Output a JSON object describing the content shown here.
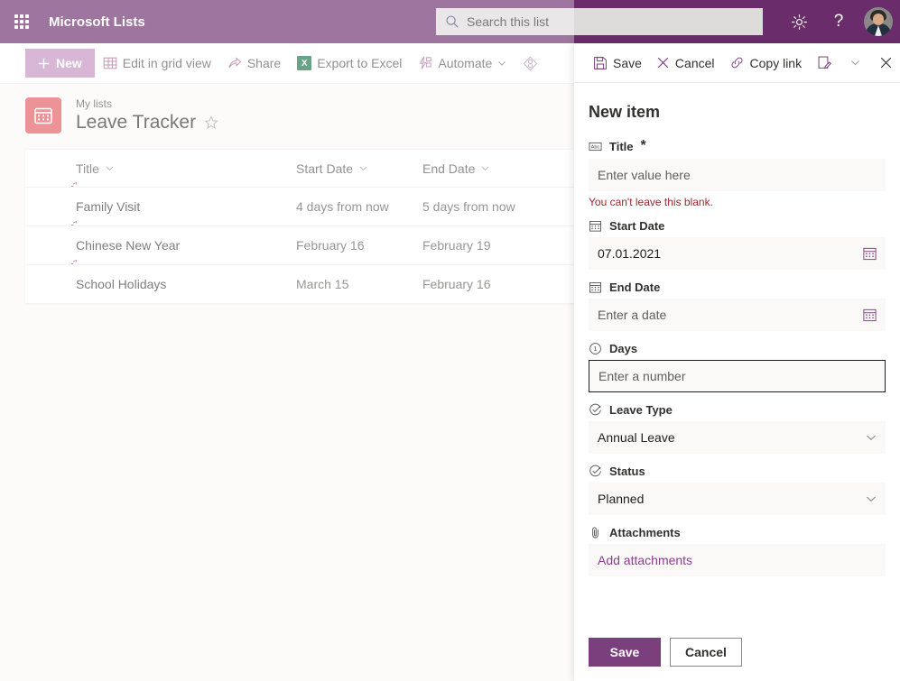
{
  "colors": {
    "brand_purple": "#6b2c6b",
    "accent_purple": "#7b3f7d",
    "new_button": "#c391c0",
    "list_icon_red": "#e35a62",
    "error_red": "#a4262c",
    "field_bg": "#faf9f8",
    "excel_green": "#1d7044"
  },
  "suitebar": {
    "waffle_name": "app-launcher",
    "app_title": "Microsoft Lists",
    "search": {
      "placeholder": "Search this list",
      "value": "",
      "icon": "search-icon"
    },
    "settings_icon": "gear-icon",
    "help_icon": "question-mark-icon",
    "avatar_name": "user-avatar"
  },
  "commandbar": {
    "new_label": "New",
    "items": [
      {
        "label": "Edit in grid view",
        "icon": "grid-icon"
      },
      {
        "label": "Share",
        "icon": "share-icon"
      },
      {
        "label": "Export to Excel",
        "icon": "excel-icon"
      },
      {
        "label": "Automate",
        "icon": "automate-icon",
        "has_chevron": true
      },
      {
        "label": "",
        "icon": "integrate-icon"
      }
    ]
  },
  "list_header": {
    "icon": "calendar-list-icon",
    "breadcrumb": "My lists",
    "title": "Leave Tracker",
    "favorite_icon": "star-icon"
  },
  "table": {
    "columns": [
      "Title",
      "Start Date",
      "End Date"
    ],
    "rows": [
      {
        "title": "Family Visit",
        "start": "4 days from now",
        "end": "5 days from now"
      },
      {
        "title": "Chinese New Year",
        "start": "February 16",
        "end": "February 19"
      },
      {
        "title": "School Holidays",
        "start": "March 15",
        "end": "February 16"
      }
    ]
  },
  "panel": {
    "commands": {
      "save": "Save",
      "cancel": "Cancel",
      "copy_link": "Copy link",
      "edit_form_icon": "edit-form-icon",
      "more_chevron_icon": "chevron-down-icon",
      "close_icon": "close-icon"
    },
    "title": "New item",
    "fields": {
      "title": {
        "label": "Title",
        "required_marker": "*",
        "icon": "text-field-icon",
        "value": "",
        "placeholder": "Enter value here",
        "error": "You can't leave this blank."
      },
      "start_date": {
        "label": "Start Date",
        "icon": "calendar-icon",
        "value": "07.01.2021",
        "placeholder": "Enter a date",
        "picker_icon": "calendar-picker-icon"
      },
      "end_date": {
        "label": "End Date",
        "icon": "calendar-icon",
        "value": "",
        "placeholder": "Enter a date",
        "picker_icon": "calendar-picker-icon"
      },
      "days": {
        "label": "Days",
        "icon": "number-field-icon",
        "value": "",
        "placeholder": "Enter a number",
        "focused": true
      },
      "leave_type": {
        "label": "Leave Type",
        "icon": "choice-field-icon",
        "value": "Annual Leave",
        "chevron_icon": "chevron-down-icon"
      },
      "status": {
        "label": "Status",
        "icon": "choice-field-icon",
        "value": "Planned",
        "chevron_icon": "chevron-down-icon"
      },
      "attachments": {
        "label": "Attachments",
        "icon": "paperclip-icon",
        "link_label": "Add attachments"
      }
    },
    "footer": {
      "save_label": "Save",
      "cancel_label": "Cancel"
    }
  }
}
